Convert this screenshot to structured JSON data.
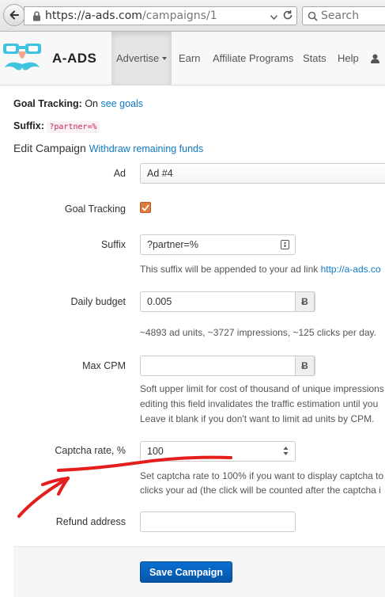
{
  "browser": {
    "url_host": "https://a-ads.com",
    "url_path": "/campaigns/1",
    "search_placeholder": "Search"
  },
  "navbar": {
    "brand": "A-ADS",
    "items": [
      {
        "label": "Advertise",
        "active": true
      },
      {
        "label": "Earn"
      },
      {
        "label": "Affiliate Programs"
      },
      {
        "label": "Stats"
      },
      {
        "label": "Help"
      }
    ]
  },
  "info": {
    "goal_tracking_label": "Goal Tracking:",
    "goal_tracking_value": "On",
    "see_goals_link": "see goals",
    "suffix_label": "Suffix:",
    "suffix_value": "?partner=%"
  },
  "edit": {
    "title": "Edit Campaign",
    "withdraw_link": "Withdraw remaining funds"
  },
  "form": {
    "ad_label": "Ad",
    "ad_value": "Ad #4",
    "goal_tracking_label": "Goal Tracking",
    "goal_tracking_checked": true,
    "suffix_label": "Suffix",
    "suffix_value": "?partner=%",
    "suffix_help_text": "This suffix will be appended to your ad link",
    "suffix_help_link": "http://a-ads.co",
    "daily_budget_label": "Daily budget",
    "daily_budget_value": "0.005",
    "currency_symbol": "Ƀ",
    "daily_budget_help": "~4893 ad units, ~3727 impressions, ~125 clicks per day.",
    "max_cpm_label": "Max CPM",
    "max_cpm_value": "",
    "max_cpm_help_1": "Soft upper limit for cost of thousand of unique impressions",
    "max_cpm_help_2": "editing this field invalidates the traffic estimation until you",
    "max_cpm_help_3": "Leave it blank if you don't want to limit ad units by CPM.",
    "captcha_label": "Captcha rate, %",
    "captcha_value": "100",
    "captcha_help_1": "Set captcha rate to 100% if you want to display captcha to",
    "captcha_help_2": "clicks your ad (the click will be counted after the captcha i",
    "refund_label": "Refund address",
    "refund_value": "",
    "save_label": "Save Campaign"
  },
  "colors": {
    "link": "#0e79c2",
    "primary_button": "#0a6fd1",
    "annotation_red": "#e41d1d",
    "logo_cyan": "#3ec3e0"
  }
}
